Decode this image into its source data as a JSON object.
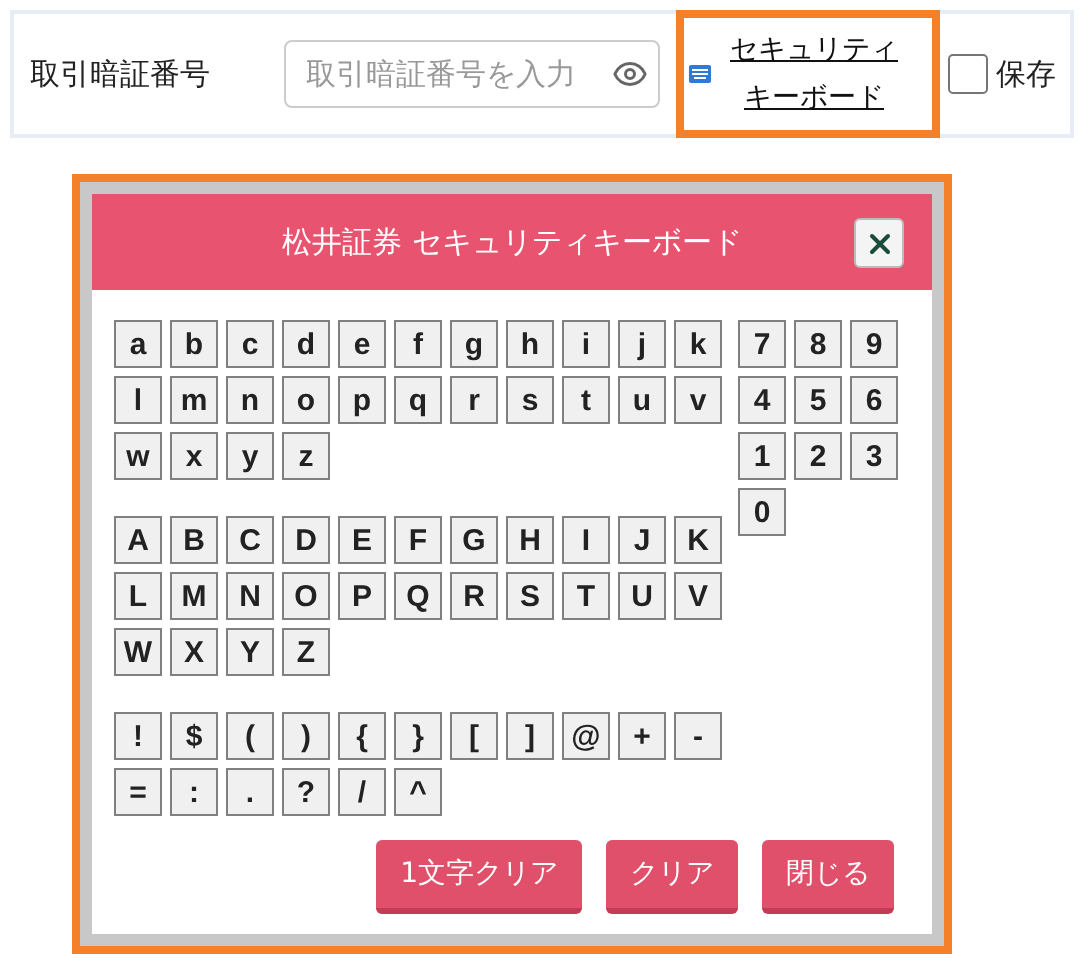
{
  "form": {
    "label": "取引暗証番号",
    "input": {
      "placeholder": "取引暗証番号を入力"
    },
    "keyboard_link": "セキュリティキーボード",
    "save": {
      "label": "保存",
      "checked": false
    }
  },
  "dialog": {
    "title": "松井証券 セキュリティキーボード",
    "lowercase": [
      "a",
      "b",
      "c",
      "d",
      "e",
      "f",
      "g",
      "h",
      "i",
      "j",
      "k",
      "l",
      "m",
      "n",
      "o",
      "p",
      "q",
      "r",
      "s",
      "t",
      "u",
      "v",
      "w",
      "x",
      "y",
      "z"
    ],
    "uppercase": [
      "A",
      "B",
      "C",
      "D",
      "E",
      "F",
      "G",
      "H",
      "I",
      "J",
      "K",
      "L",
      "M",
      "N",
      "O",
      "P",
      "Q",
      "R",
      "S",
      "T",
      "U",
      "V",
      "W",
      "X",
      "Y",
      "Z"
    ],
    "symbols": [
      "!",
      "$",
      "(",
      ")",
      "{",
      "}",
      "[",
      "]",
      "@",
      "+",
      "-",
      "=",
      ":",
      ".",
      "?",
      "/",
      "^"
    ],
    "digits": [
      "7",
      "8",
      "9",
      "4",
      "5",
      "6",
      "1",
      "2",
      "3",
      "0"
    ],
    "buttons": [
      "1文字クリア",
      "クリア",
      "閉じる"
    ]
  }
}
